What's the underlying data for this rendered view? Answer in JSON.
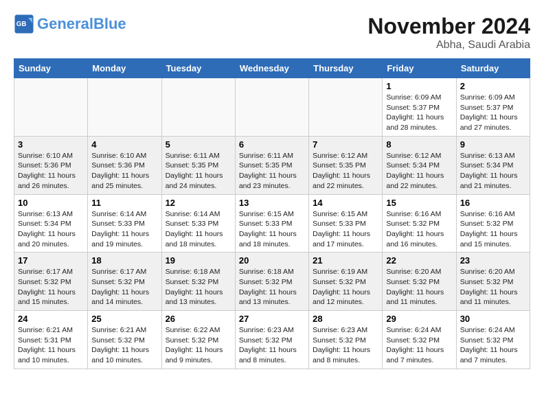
{
  "header": {
    "logo_general": "General",
    "logo_blue": "Blue",
    "month": "November 2024",
    "location": "Abha, Saudi Arabia"
  },
  "days_of_week": [
    "Sunday",
    "Monday",
    "Tuesday",
    "Wednesday",
    "Thursday",
    "Friday",
    "Saturday"
  ],
  "weeks": [
    {
      "row": 1,
      "days": [
        {
          "num": "",
          "content": ""
        },
        {
          "num": "",
          "content": ""
        },
        {
          "num": "",
          "content": ""
        },
        {
          "num": "",
          "content": ""
        },
        {
          "num": "",
          "content": ""
        },
        {
          "num": "1",
          "content": "Sunrise: 6:09 AM\nSunset: 5:37 PM\nDaylight: 11 hours and 28 minutes."
        },
        {
          "num": "2",
          "content": "Sunrise: 6:09 AM\nSunset: 5:37 PM\nDaylight: 11 hours and 27 minutes."
        }
      ]
    },
    {
      "row": 2,
      "days": [
        {
          "num": "3",
          "content": "Sunrise: 6:10 AM\nSunset: 5:36 PM\nDaylight: 11 hours and 26 minutes."
        },
        {
          "num": "4",
          "content": "Sunrise: 6:10 AM\nSunset: 5:36 PM\nDaylight: 11 hours and 25 minutes."
        },
        {
          "num": "5",
          "content": "Sunrise: 6:11 AM\nSunset: 5:35 PM\nDaylight: 11 hours and 24 minutes."
        },
        {
          "num": "6",
          "content": "Sunrise: 6:11 AM\nSunset: 5:35 PM\nDaylight: 11 hours and 23 minutes."
        },
        {
          "num": "7",
          "content": "Sunrise: 6:12 AM\nSunset: 5:35 PM\nDaylight: 11 hours and 22 minutes."
        },
        {
          "num": "8",
          "content": "Sunrise: 6:12 AM\nSunset: 5:34 PM\nDaylight: 11 hours and 22 minutes."
        },
        {
          "num": "9",
          "content": "Sunrise: 6:13 AM\nSunset: 5:34 PM\nDaylight: 11 hours and 21 minutes."
        }
      ]
    },
    {
      "row": 3,
      "days": [
        {
          "num": "10",
          "content": "Sunrise: 6:13 AM\nSunset: 5:34 PM\nDaylight: 11 hours and 20 minutes."
        },
        {
          "num": "11",
          "content": "Sunrise: 6:14 AM\nSunset: 5:33 PM\nDaylight: 11 hours and 19 minutes."
        },
        {
          "num": "12",
          "content": "Sunrise: 6:14 AM\nSunset: 5:33 PM\nDaylight: 11 hours and 18 minutes."
        },
        {
          "num": "13",
          "content": "Sunrise: 6:15 AM\nSunset: 5:33 PM\nDaylight: 11 hours and 18 minutes."
        },
        {
          "num": "14",
          "content": "Sunrise: 6:15 AM\nSunset: 5:33 PM\nDaylight: 11 hours and 17 minutes."
        },
        {
          "num": "15",
          "content": "Sunrise: 6:16 AM\nSunset: 5:32 PM\nDaylight: 11 hours and 16 minutes."
        },
        {
          "num": "16",
          "content": "Sunrise: 6:16 AM\nSunset: 5:32 PM\nDaylight: 11 hours and 15 minutes."
        }
      ]
    },
    {
      "row": 4,
      "days": [
        {
          "num": "17",
          "content": "Sunrise: 6:17 AM\nSunset: 5:32 PM\nDaylight: 11 hours and 15 minutes."
        },
        {
          "num": "18",
          "content": "Sunrise: 6:17 AM\nSunset: 5:32 PM\nDaylight: 11 hours and 14 minutes."
        },
        {
          "num": "19",
          "content": "Sunrise: 6:18 AM\nSunset: 5:32 PM\nDaylight: 11 hours and 13 minutes."
        },
        {
          "num": "20",
          "content": "Sunrise: 6:18 AM\nSunset: 5:32 PM\nDaylight: 11 hours and 13 minutes."
        },
        {
          "num": "21",
          "content": "Sunrise: 6:19 AM\nSunset: 5:32 PM\nDaylight: 11 hours and 12 minutes."
        },
        {
          "num": "22",
          "content": "Sunrise: 6:20 AM\nSunset: 5:32 PM\nDaylight: 11 hours and 11 minutes."
        },
        {
          "num": "23",
          "content": "Sunrise: 6:20 AM\nSunset: 5:32 PM\nDaylight: 11 hours and 11 minutes."
        }
      ]
    },
    {
      "row": 5,
      "days": [
        {
          "num": "24",
          "content": "Sunrise: 6:21 AM\nSunset: 5:31 PM\nDaylight: 11 hours and 10 minutes."
        },
        {
          "num": "25",
          "content": "Sunrise: 6:21 AM\nSunset: 5:32 PM\nDaylight: 11 hours and 10 minutes."
        },
        {
          "num": "26",
          "content": "Sunrise: 6:22 AM\nSunset: 5:32 PM\nDaylight: 11 hours and 9 minutes."
        },
        {
          "num": "27",
          "content": "Sunrise: 6:23 AM\nSunset: 5:32 PM\nDaylight: 11 hours and 8 minutes."
        },
        {
          "num": "28",
          "content": "Sunrise: 6:23 AM\nSunset: 5:32 PM\nDaylight: 11 hours and 8 minutes."
        },
        {
          "num": "29",
          "content": "Sunrise: 6:24 AM\nSunset: 5:32 PM\nDaylight: 11 hours and 7 minutes."
        },
        {
          "num": "30",
          "content": "Sunrise: 6:24 AM\nSunset: 5:32 PM\nDaylight: 11 hours and 7 minutes."
        }
      ]
    }
  ]
}
